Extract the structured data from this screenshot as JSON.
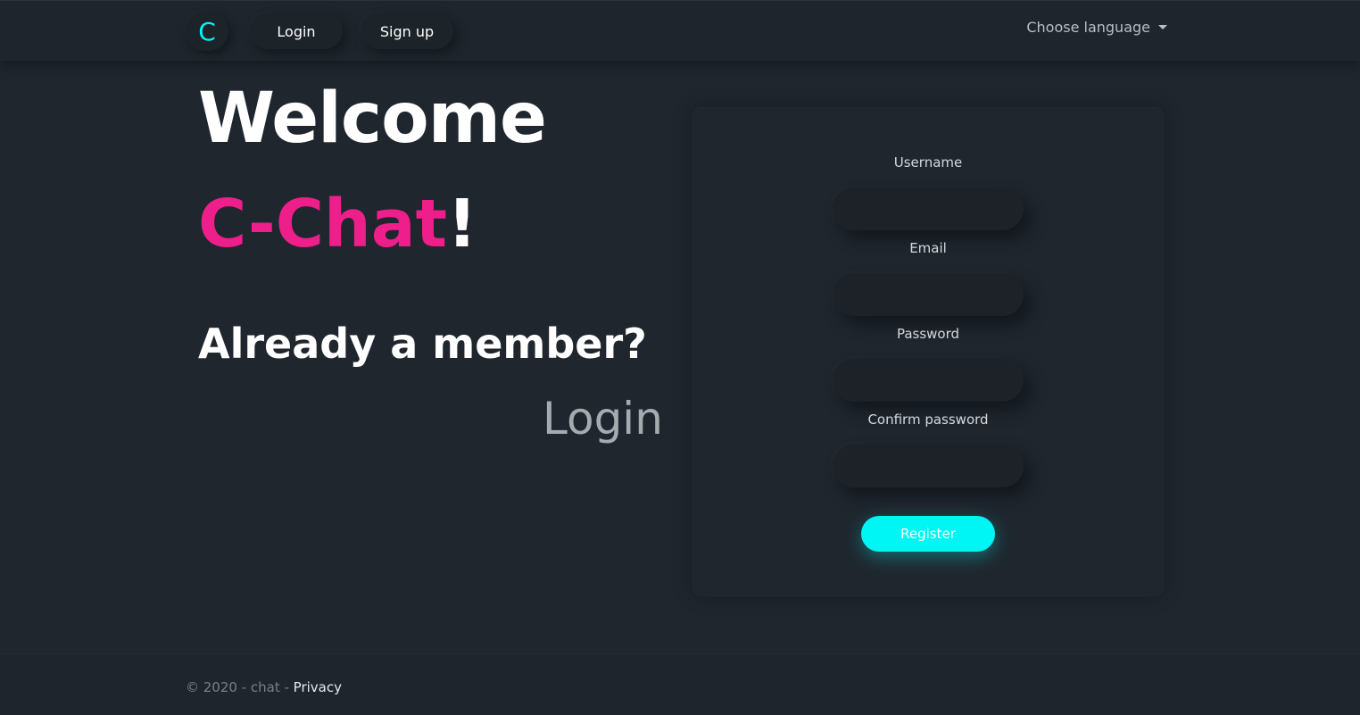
{
  "nav": {
    "brand_glyph": "C",
    "login_label": "Login",
    "signup_label": "Sign up",
    "language_label": "Choose language"
  },
  "hero": {
    "welcome": "Welcome",
    "app_name": "C-Chat",
    "exclaim": "!",
    "member_question": "Already a member?",
    "login_link": "Login"
  },
  "form": {
    "username_label": "Username",
    "email_label": "Email",
    "password_label": "Password",
    "confirm_label": "Confirm password",
    "username_value": "",
    "email_value": "",
    "password_value": "",
    "confirm_value": "",
    "register_label": "Register"
  },
  "footer": {
    "copyright": "© 2020 - chat - ",
    "privacy": "Privacy"
  },
  "colors": {
    "accent_cyan": "#00f5f5",
    "brand_pink": "#ee1e8b",
    "background": "#1f262e"
  }
}
